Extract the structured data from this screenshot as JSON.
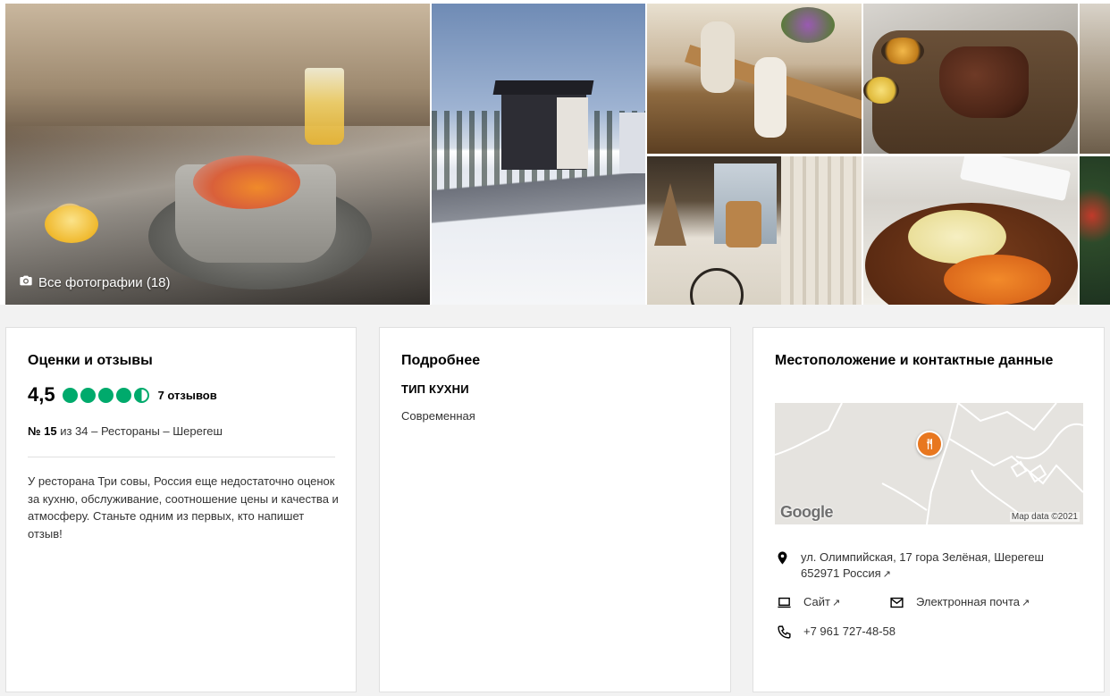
{
  "gallery": {
    "all_photos_label": "Все фотографии (18)"
  },
  "ratings": {
    "title": "Оценки и отзывы",
    "score": "4,5",
    "bubble_rating": 4.5,
    "reviews": "7 отзывов",
    "rank_number": "№ 15",
    "rank_rest": " из 34 – Рестораны – Шерегеш",
    "description": "У ресторана Три совы, Россия еще недостаточно оценок за кухню, обслуживание, соотношение цены и качества и атмосферу. Станьте одним из первых, кто напишет отзыв!",
    "bubble_color": "#00aa6c"
  },
  "details": {
    "title": "Подробнее",
    "cuisine_label": "ТИП КУХНИ",
    "cuisine_value": "Современная"
  },
  "location": {
    "title": "Местоположение и контактные данные",
    "map_logo": "Google",
    "map_data": "Map data ©2021",
    "address": "ул. Олимпийская, 17 гора Зелёная, Шерегеш 652971 Россия",
    "site_label": "Сайт",
    "email_label": "Электронная почта",
    "phone": "+7 961 727-48-58",
    "pin_color": "#e8771f"
  },
  "icons": {
    "camera": "camera-icon",
    "pin": "location-pin-icon",
    "laptop": "laptop-icon",
    "mail": "mail-icon",
    "phone": "phone-icon",
    "external": "external-link-icon",
    "fork": "fork-knife-icon"
  }
}
